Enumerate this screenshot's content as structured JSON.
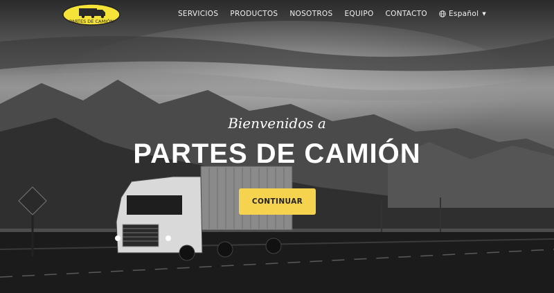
{
  "brand": {
    "logo_text": "PARTES DE CAMIÓN",
    "logo_color": "#f6e33a"
  },
  "nav": {
    "items": [
      {
        "label": "SERVICIOS"
      },
      {
        "label": "PRODUCTOS"
      },
      {
        "label": "NOSOTROS"
      },
      {
        "label": "EQUIPO"
      },
      {
        "label": "CONTACTO"
      }
    ],
    "language": {
      "label": "Español",
      "icon": "globe-icon"
    }
  },
  "hero": {
    "welcome": "Bienvenidos a",
    "title": "PARTES DE CAMIÓN",
    "cta_label": "CONTINUAR",
    "cta_color": "#f6d34f"
  }
}
